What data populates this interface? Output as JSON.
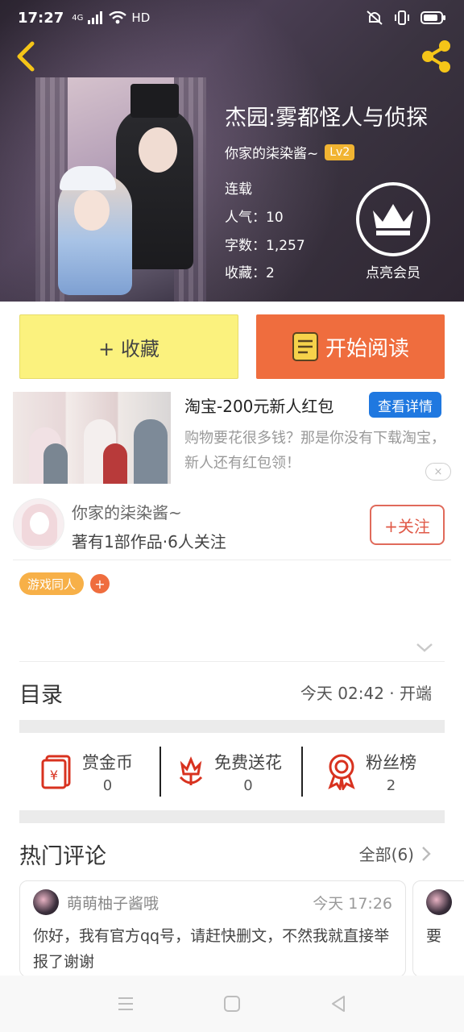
{
  "status_bar": {
    "time": "17:27",
    "network": "4G",
    "hd": "HD"
  },
  "book": {
    "title": "杰园:雾都怪人与侦探",
    "author": "你家的柒染酱~",
    "level": "Lv2",
    "status": "连载",
    "popularity": "人气：10",
    "word_count": "字数：1,257",
    "favorites": "收藏：2"
  },
  "vip": {
    "label": "点亮会员"
  },
  "actions": {
    "collect_label": "+ 收藏",
    "read_label": "开始阅读"
  },
  "ad": {
    "title": "淘宝-200元新人红包",
    "detail_label": "查看详情",
    "description": "购物要花很多钱？那是你没有下载淘宝，新人还有红包领！",
    "close_label": "×"
  },
  "author_section": {
    "name": "你家的柒染酱~",
    "summary": "著有1部作品·6人关注",
    "follow_label": "+关注"
  },
  "tags": [
    {
      "label": "游戏同人"
    }
  ],
  "tag_add_label": "+",
  "toc": {
    "label": "目录",
    "meta": "今天 02:42 · 开端"
  },
  "stats": [
    {
      "title": "赏金币",
      "value": "0",
      "icon": "red-envelope-icon"
    },
    {
      "title": "免费送花",
      "value": "0",
      "icon": "flower-icon"
    },
    {
      "title": "粉丝榜",
      "value": "2",
      "icon": "ribbon-medal-icon"
    }
  ],
  "comments_section": {
    "label": "热门评论",
    "all_label": "全部(6)",
    "items": [
      {
        "user": "萌萌柚子酱哦",
        "time": "今天 17:26",
        "text": "你好，我有官方qq号，请赶快删文，不然我就直接举报了谢谢"
      },
      {
        "text": "要"
      }
    ]
  },
  "colors": {
    "accent_orange": "#ef6d3e",
    "collect_yellow": "#fbf27e",
    "ad_blue": "#1f78e0",
    "tag_orange": "#f7b048",
    "follow_red": "#e05a48",
    "level_badge": "#f1b432"
  }
}
